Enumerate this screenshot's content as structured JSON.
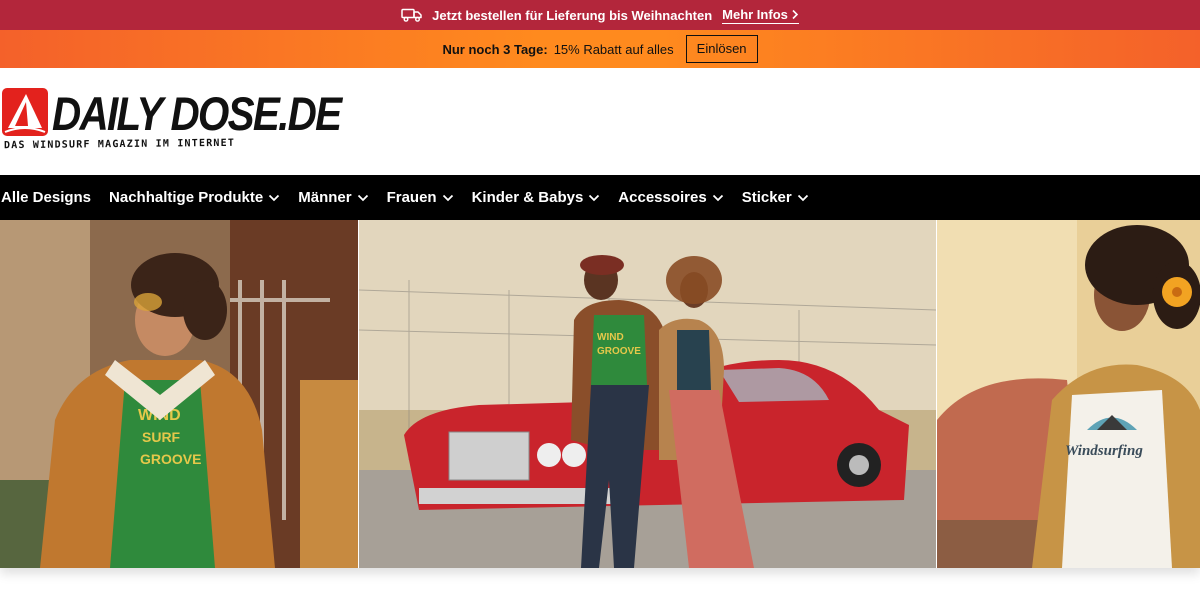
{
  "topbar": {
    "text": "Jetzt bestellen für Lieferung bis Weihnachten",
    "link": "Mehr Infos",
    "icon": "truck-icon",
    "background": "#b3263b"
  },
  "promo": {
    "bold": "Nur noch 3 Tage:",
    "text": "15% Rabatt auf alles",
    "button": "Einlösen"
  },
  "logo": {
    "name": "DAILY DOSE.DE",
    "tagline": "DAS WINDSURF MAGAZIN IM INTERNET",
    "accent": "#e3221d"
  },
  "nav": {
    "items": [
      {
        "label": "Alle Designs",
        "dropdown": false
      },
      {
        "label": "Nachhaltige Produkte",
        "dropdown": true
      },
      {
        "label": "Männer",
        "dropdown": true
      },
      {
        "label": "Frauen",
        "dropdown": true
      },
      {
        "label": "Kinder & Babys",
        "dropdown": true
      },
      {
        "label": "Accessoires",
        "dropdown": true
      },
      {
        "label": "Sticker",
        "dropdown": true
      }
    ]
  },
  "hero": {
    "shirt_prints": [
      "WIND SURF GROOVE",
      "WIND SURF GROOVE",
      "Windsurfing"
    ]
  }
}
